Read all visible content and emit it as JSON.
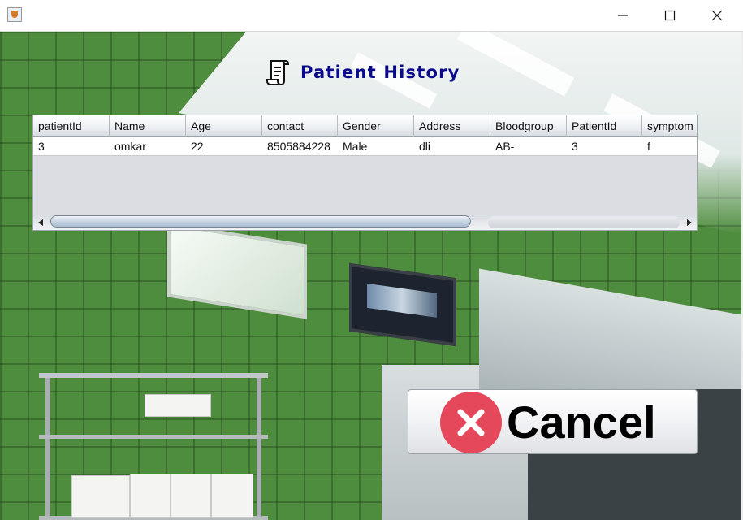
{
  "window": {
    "title": "",
    "controls": [
      "minimize-icon",
      "maximize-icon",
      "close-icon"
    ]
  },
  "page": {
    "title": "Patient History",
    "title_icon": "scroll-document-icon"
  },
  "table": {
    "columns": [
      "patientId",
      "Name",
      "Age",
      "contact",
      "Gender",
      "Address",
      "Bloodgroup",
      "PatientId",
      "symptom"
    ],
    "rows": [
      [
        "3",
        "omkar",
        "22",
        "8505884228",
        "Male",
        "dli",
        "AB-",
        "3",
        "f"
      ]
    ],
    "horizontal_scrollbar": true
  },
  "actions": {
    "cancel_label": "Cancel",
    "cancel_icon": "x-circle-icon",
    "cancel_icon_color": "#e5485b"
  }
}
